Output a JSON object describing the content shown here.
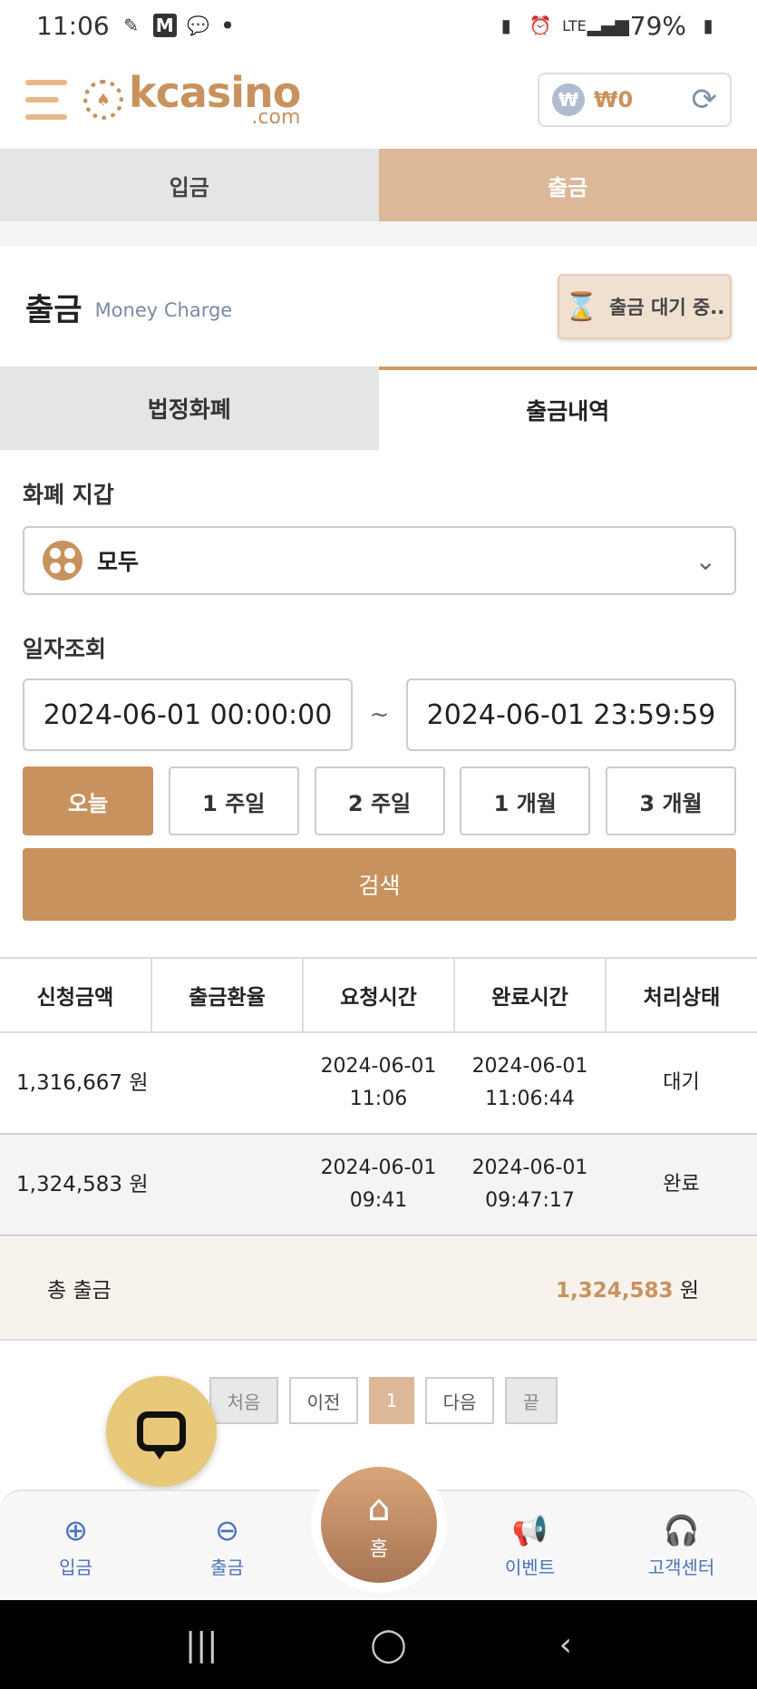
{
  "status_bar": {
    "time": "11:06",
    "battery": "79%",
    "network": "LTE",
    "dot": "•"
  },
  "header": {
    "logo_main": "kcasino",
    "logo_sub": ".com",
    "wallet_amount": "₩0",
    "won_symbol": "₩"
  },
  "top_tabs": [
    {
      "label": "입금"
    },
    {
      "label": "출금"
    }
  ],
  "section": {
    "title": "출금",
    "subtitle": "Money Charge",
    "pending_label": "출금 대기 중.."
  },
  "sub_tabs": [
    {
      "label": "법정화폐"
    },
    {
      "label": "출금내역"
    }
  ],
  "wallet_filter": {
    "label": "화폐 지갑",
    "selected": "모두"
  },
  "date_filter": {
    "label": "일자조회",
    "start": "2024-06-01 00:00:00",
    "end": "2024-06-01 23:59:59",
    "separator": "~"
  },
  "ranges": [
    {
      "label": "오늘"
    },
    {
      "label": "1 주일"
    },
    {
      "label": "2 주일"
    },
    {
      "label": "1 개월"
    },
    {
      "label": "3 개월"
    }
  ],
  "search_label": "검색",
  "table": {
    "headers": [
      "신청금액",
      "출금환율",
      "요청시간",
      "완료시간",
      "처리상태"
    ],
    "rows": [
      {
        "amount": "1,316,667 원",
        "rate": "",
        "req_date": "2024-06-01",
        "req_time": "11:06",
        "done_date": "2024-06-01",
        "done_time": "11:06:44",
        "status": "대기"
      },
      {
        "amount": "1,324,583 원",
        "rate": "",
        "req_date": "2024-06-01",
        "req_time": "09:41",
        "done_date": "2024-06-01",
        "done_time": "09:47:17",
        "status": "완료"
      }
    ]
  },
  "total": {
    "label": "총 출금",
    "value": "1,324,583",
    "unit": "원"
  },
  "pager": {
    "first": "처음",
    "prev": "이전",
    "current": "1",
    "next": "다음",
    "last": "끝"
  },
  "bottom_nav": {
    "deposit": "입금",
    "withdraw": "출금",
    "home": "홈",
    "event": "이벤트",
    "support": "고객센터"
  },
  "colors": {
    "accent": "#c8925e",
    "tab_active": "#dcb898",
    "done": "#48c248",
    "nav": "#4a73b8"
  }
}
